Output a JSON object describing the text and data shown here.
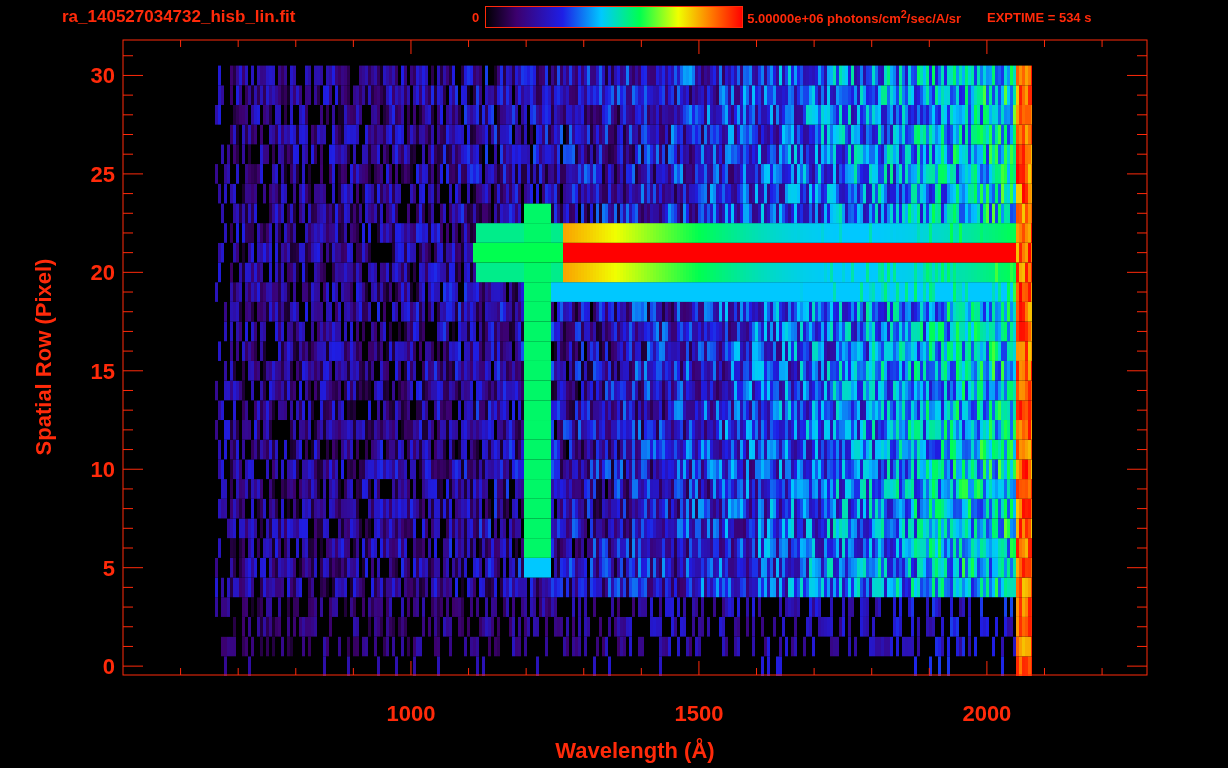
{
  "header": {
    "filename": "ra_140527034732_hisb_lin.fit",
    "colorbar_min": "0",
    "colorbar_max": "5.00000e+06 photons/cm$^{2}$/sec/A/sr",
    "exposure": "EXPTIME = 534 s"
  },
  "plot": {
    "ylabel": "Spatial Row (Pixel)",
    "xlabel": "Wavelength (Å)",
    "yticks": [
      "30",
      "25",
      "20",
      "15",
      "10",
      "5",
      "0"
    ],
    "xticks": [
      "1000",
      "1500",
      "2000"
    ]
  }
}
